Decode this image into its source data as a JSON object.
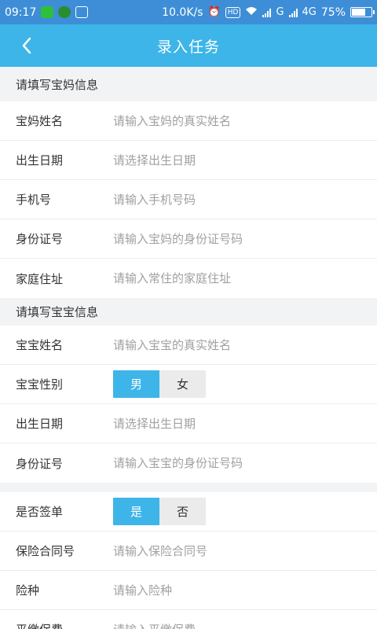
{
  "status_bar": {
    "time": "09:17",
    "speed": "10.0K/s",
    "hd": "HD",
    "network_g": "G",
    "network_4g": "4G",
    "battery_percent": "75%",
    "battery_level": 0.75
  },
  "header": {
    "title": "录入任务"
  },
  "mother_section": {
    "title": "请填写宝妈信息",
    "fields": [
      {
        "label": "宝妈姓名",
        "placeholder": "请输入宝妈的真实姓名"
      },
      {
        "label": "出生日期",
        "placeholder": "请选择出生日期"
      },
      {
        "label": "手机号",
        "placeholder": "请输入手机号码"
      },
      {
        "label": "身份证号",
        "placeholder": "请输入宝妈的身份证号码"
      },
      {
        "label": "家庭住址",
        "placeholder": "请输入常住的家庭住址"
      }
    ]
  },
  "baby_section": {
    "title": "请填写宝宝信息",
    "name": {
      "label": "宝宝姓名",
      "placeholder": "请输入宝宝的真实姓名"
    },
    "gender": {
      "label": "宝宝性别",
      "options": [
        "男",
        "女"
      ],
      "selected": "男"
    },
    "birth": {
      "label": "出生日期",
      "placeholder": "请选择出生日期"
    },
    "id_card": {
      "label": "身份证号",
      "placeholder": "请输入宝宝的身份证号码"
    }
  },
  "contract_section": {
    "signed": {
      "label": "是否签单",
      "options": [
        "是",
        "否"
      ],
      "selected": "是"
    },
    "contract_no": {
      "label": "保险合同号",
      "placeholder": "请输入保险合同号"
    },
    "insurance_type": {
      "label": "险种",
      "placeholder": "请输入险种"
    },
    "premium": {
      "label": "平缴保费",
      "placeholder": "请输入平缴保费"
    }
  },
  "colors": {
    "status_bar": "#3d8ed6",
    "nav_bar": "#3db5e8",
    "accent": "#3db5e8",
    "background": "#f2f3f5"
  }
}
